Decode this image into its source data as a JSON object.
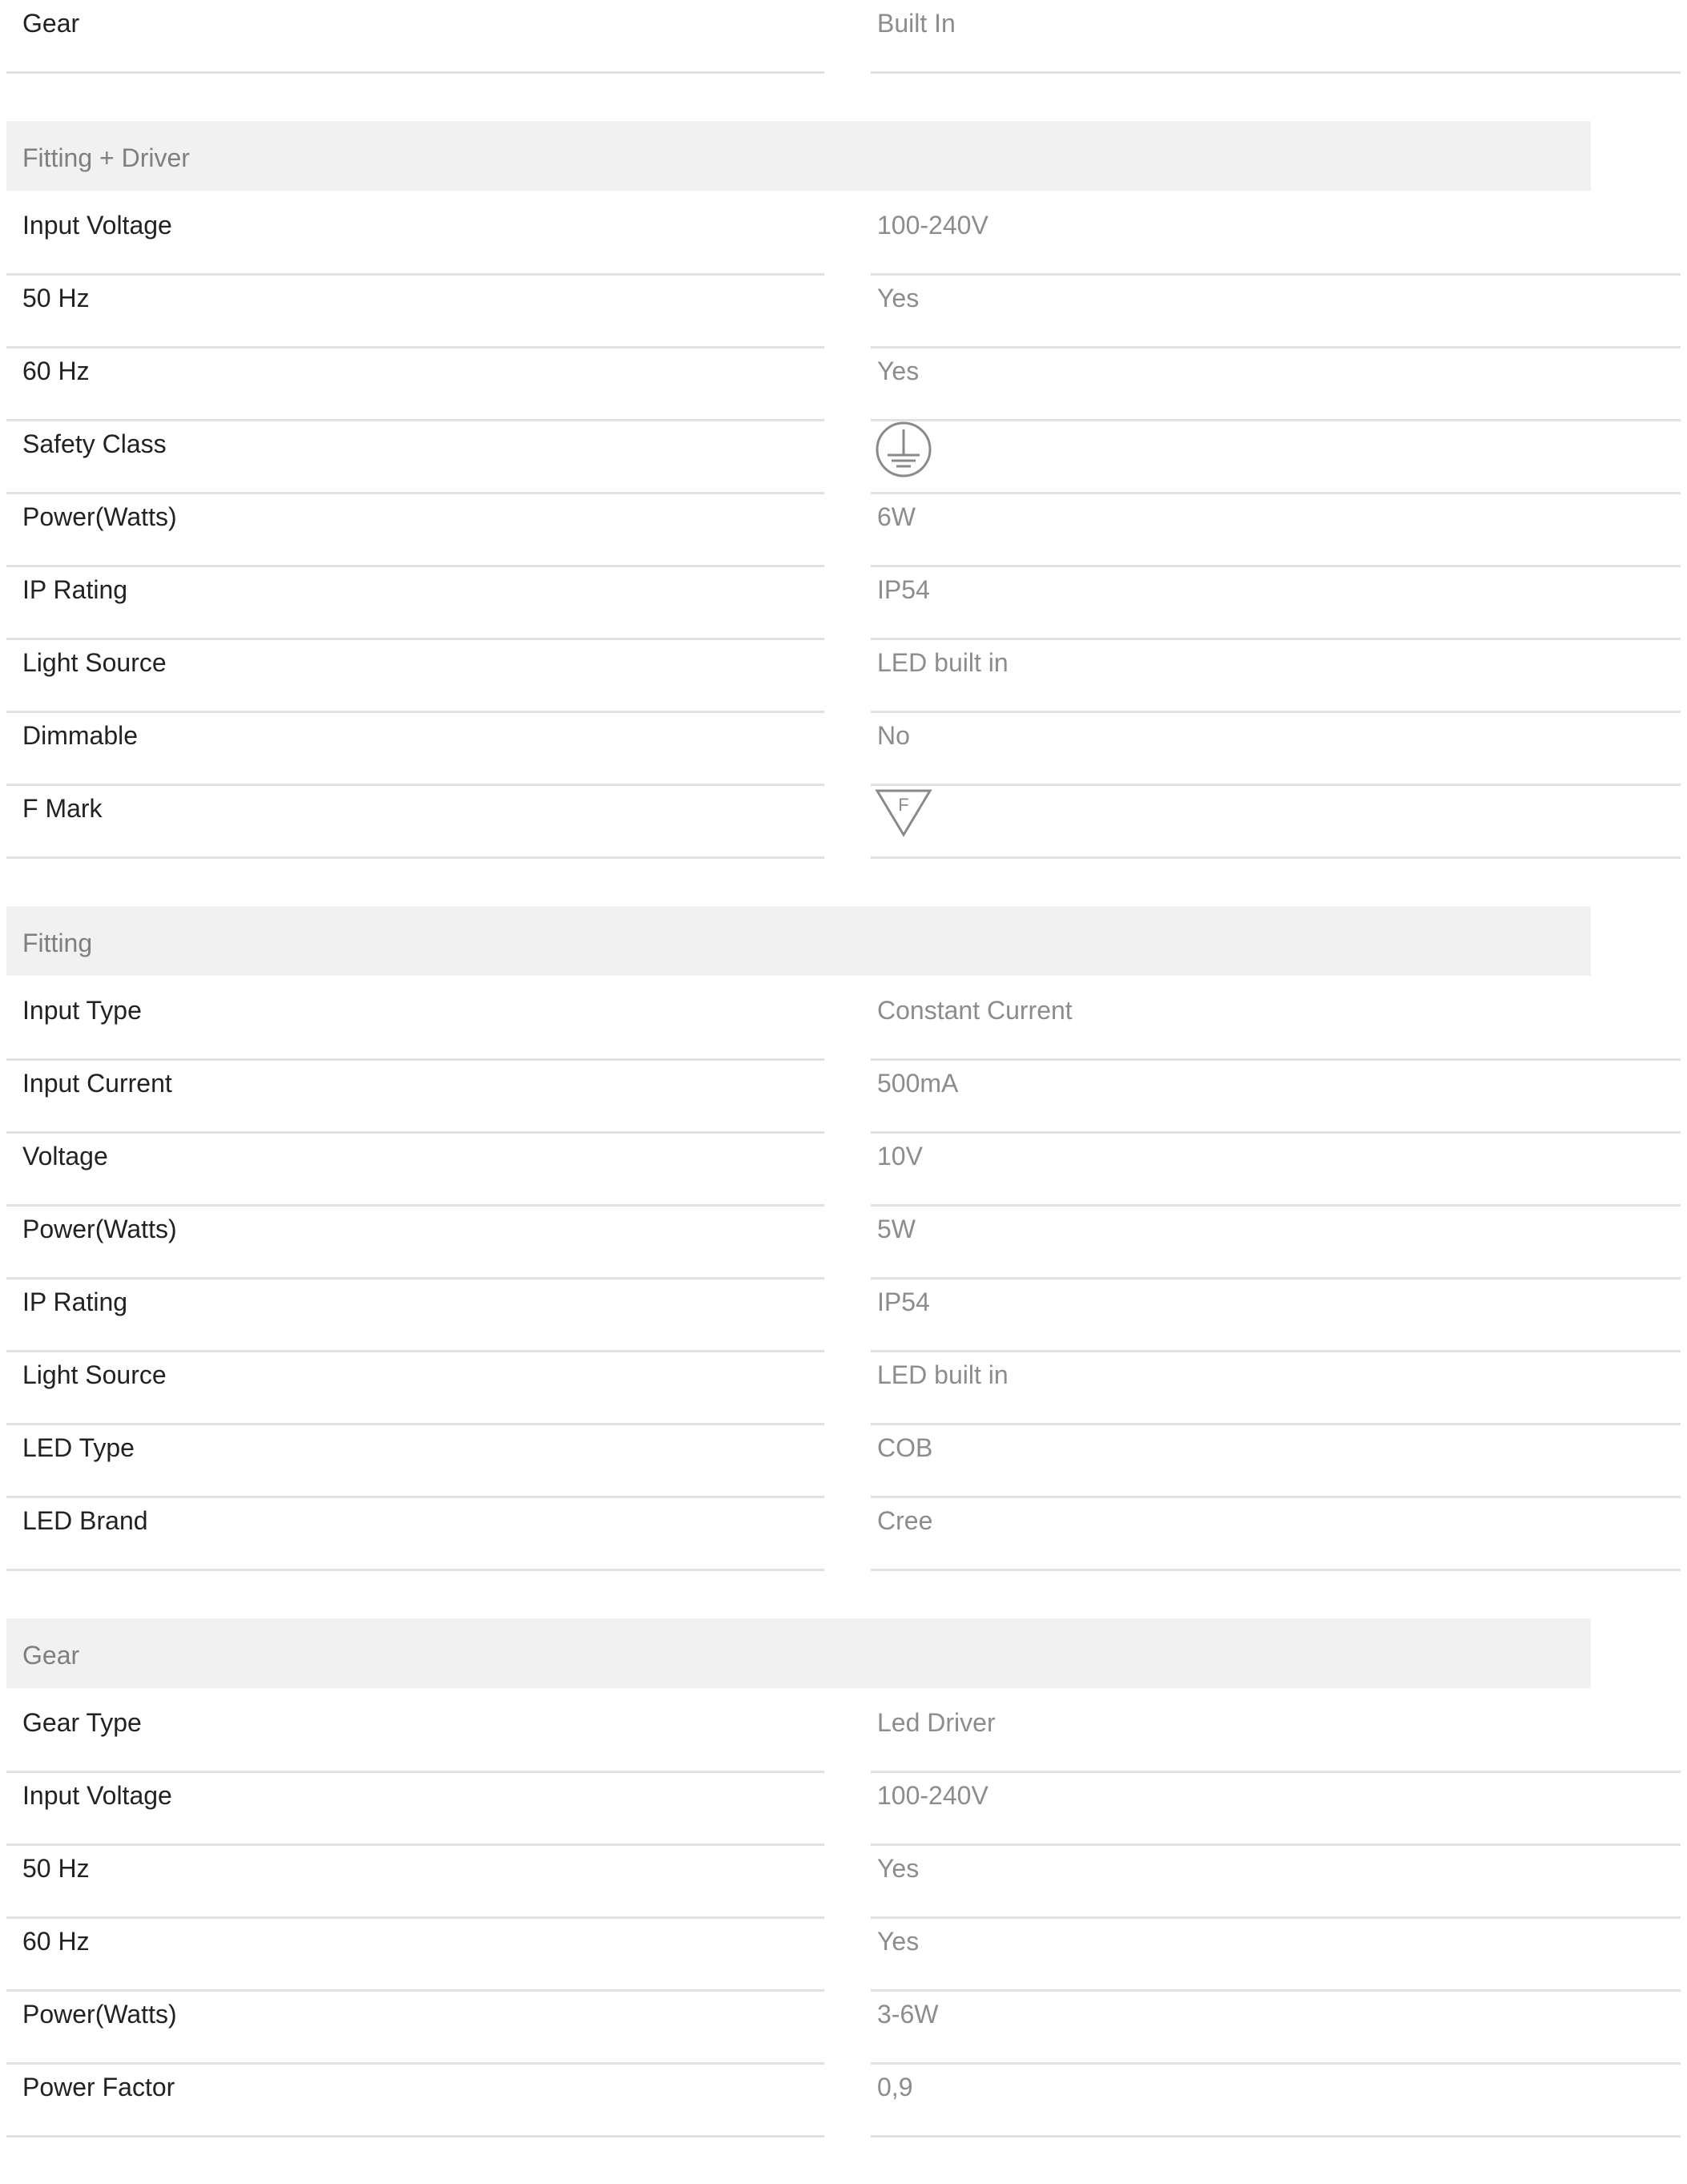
{
  "top_rows": [
    {
      "label": "Gear",
      "value": "Built In"
    }
  ],
  "sections": [
    {
      "title": "Fitting + Driver",
      "rows": [
        {
          "label": "Input Voltage",
          "value": "100-240V"
        },
        {
          "label": "50 Hz",
          "value": "Yes"
        },
        {
          "label": "60 Hz",
          "value": "Yes"
        },
        {
          "label": "Safety Class",
          "value": "",
          "icon": "earth-ground-icon"
        },
        {
          "label": "Power(Watts)",
          "value": "6W"
        },
        {
          "label": "IP Rating",
          "value": "IP54"
        },
        {
          "label": "Light Source",
          "value": "LED built in"
        },
        {
          "label": "Dimmable",
          "value": "No"
        },
        {
          "label": "F Mark",
          "value": "",
          "icon": "f-mark-icon",
          "icon_text": "F"
        }
      ]
    },
    {
      "title": "Fitting",
      "rows": [
        {
          "label": "Input Type",
          "value": "Constant Current"
        },
        {
          "label": "Input Current",
          "value": "500mA"
        },
        {
          "label": "Voltage",
          "value": "10V"
        },
        {
          "label": "Power(Watts)",
          "value": "5W"
        },
        {
          "label": "IP Rating",
          "value": "IP54"
        },
        {
          "label": "Light Source",
          "value": "LED built in"
        },
        {
          "label": "LED Type",
          "value": "COB"
        },
        {
          "label": "LED Brand",
          "value": "Cree"
        }
      ]
    },
    {
      "title": "Gear",
      "rows": [
        {
          "label": "Gear Type",
          "value": "Led Driver"
        },
        {
          "label": "Input Voltage",
          "value": "100-240V"
        },
        {
          "label": "50 Hz",
          "value": "Yes"
        },
        {
          "label": "60 Hz",
          "value": "Yes"
        },
        {
          "label": "Power(Watts)",
          "value": "3-6W"
        },
        {
          "label": "Power Factor",
          "value": "0,9"
        }
      ]
    }
  ],
  "colors": {
    "label_text": "#222222",
    "value_text": "#8c8c8c",
    "header_bg": "#f1f1f1",
    "header_text": "#7f7f7f",
    "divider": "#e1e1e1",
    "icon_stroke": "#8a8a8a"
  }
}
